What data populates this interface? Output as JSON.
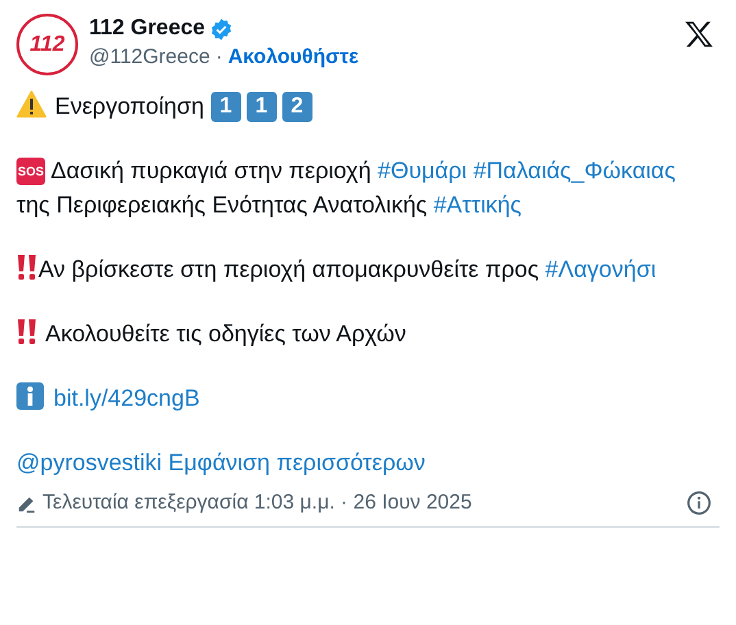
{
  "account": {
    "name": "112 Greece",
    "verified": true,
    "handle": "@112Greece",
    "separator": "·",
    "follow": "Ακολουθήστε",
    "avatar_text": "112"
  },
  "paragraphs": [
    {
      "kind": "warning",
      "segments": [
        {
          "kind": "text",
          "text": "Ενεργοποίηση"
        }
      ],
      "keycaps": [
        "1",
        "1",
        "2"
      ]
    },
    {
      "kind": "sos",
      "icon_text": "SOS",
      "segments": [
        {
          "kind": "text",
          "text": "Δασική πυρκαγιά στην περιοχή"
        },
        {
          "kind": "hashtag",
          "text": "#Θυμάρι"
        },
        {
          "kind": "hashtag",
          "text": "#Παλαιάς_Φώκαιας"
        },
        {
          "kind": "text",
          "text": "της Περιφερειακής Ενότητας Ανατολικής"
        },
        {
          "kind": "hashtag",
          "text": "#Αττικής"
        }
      ]
    },
    {
      "kind": "bangbang",
      "segments": [
        {
          "kind": "text",
          "text": "Αν βρίσκεστε στη περιοχή απομακρυνθείτε προς"
        },
        {
          "kind": "hashtag",
          "text": "#Λαγονήσι"
        }
      ]
    },
    {
      "kind": "bangbang_spaced",
      "segments": [
        {
          "kind": "text",
          "text": "Ακολουθείτε τις οδηγίες των Αρχών"
        }
      ]
    },
    {
      "kind": "info",
      "segments": [
        {
          "kind": "hashtag",
          "text": "bit.ly/429cngB"
        }
      ]
    },
    {
      "kind": "plain",
      "segments": [
        {
          "kind": "hashtag",
          "text": "@pyrosvestiki"
        },
        {
          "kind": "hashtag",
          "text": "Εμφάνιση περισσότερων"
        }
      ]
    }
  ],
  "footer": {
    "edited": true,
    "text": "Τελευταία επεξεργασία 1:03 μ.μ. · 26 Ιουν 2025"
  }
}
